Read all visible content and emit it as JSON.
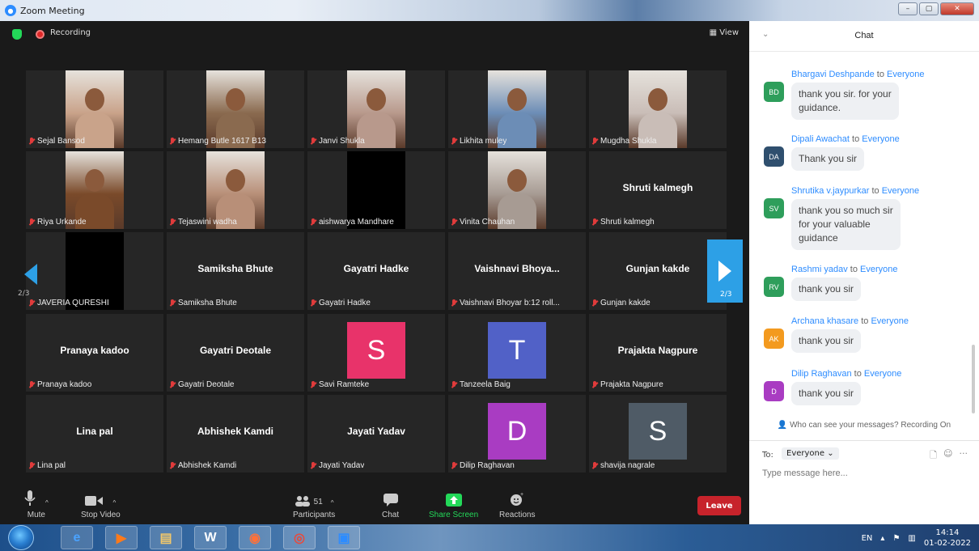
{
  "window": {
    "title": "Zoom Meeting"
  },
  "meeting": {
    "recording_label": "Recording",
    "view_label": "View",
    "page_indicator_left": "2/3",
    "page_indicator_right": "2/3",
    "tiles": [
      {
        "label": "Sejal Bansod",
        "type": "video",
        "bg": "#c9a38a"
      },
      {
        "label": "Hemang Butle 1617 B13",
        "type": "video",
        "bg": "#8a6a4f"
      },
      {
        "label": "Janvi Shukla",
        "type": "video",
        "bg": "#b8998c"
      },
      {
        "label": "Likhita muley",
        "type": "video",
        "bg": "#6c8db6"
      },
      {
        "label": "Mugdha Shukla",
        "type": "video",
        "bg": "#c9bdb7"
      },
      {
        "label": "Riya Urkande",
        "type": "video",
        "bg": "#7a4a2a"
      },
      {
        "label": "Tejaswini wadha",
        "type": "video",
        "bg": "#b88f78"
      },
      {
        "label": "aishwarya Mandhare",
        "type": "black",
        "bg": "#000000"
      },
      {
        "label": "Vinita Chauhan",
        "type": "video",
        "bg": "#a79b93"
      },
      {
        "label": "Shruti kalmegh",
        "type": "name",
        "name": "Shruti kalmegh"
      },
      {
        "label": "JAVERIA QURESHI",
        "type": "black",
        "bg": "#000000"
      },
      {
        "label": "Samiksha Bhute",
        "type": "name",
        "name": "Samiksha Bhute"
      },
      {
        "label": "Gayatri Hadke",
        "type": "name",
        "name": "Gayatri Hadke"
      },
      {
        "label": "Vaishnavi Bhoyar b:12 roll...",
        "type": "name",
        "name": "Vaishnavi  Bhoya..."
      },
      {
        "label": "Gunjan kakde",
        "type": "name",
        "name": "Gunjan kakde"
      },
      {
        "label": "Pranaya kadoo",
        "type": "name",
        "name": "Pranaya kadoo"
      },
      {
        "label": "Gayatri Deotale",
        "type": "name",
        "name": "Gayatri Deotale"
      },
      {
        "label": "Savi Ramteke",
        "type": "avatar",
        "letter": "S",
        "bg": "#e8336a"
      },
      {
        "label": "Tanzeela Baig",
        "type": "avatar",
        "letter": "T",
        "bg": "#5161c7"
      },
      {
        "label": "Prajakta Nagpure",
        "type": "name",
        "name": "Prajakta Nagpure"
      },
      {
        "label": "Lina pal",
        "type": "name",
        "name": "Lina pal"
      },
      {
        "label": "Abhishek Kamdi",
        "type": "name",
        "name": "Abhishek Kamdi"
      },
      {
        "label": "Jayati Yadav",
        "type": "name",
        "name": "Jayati Yadav"
      },
      {
        "label": "Dilip Raghavan",
        "type": "avatar",
        "letter": "D",
        "bg": "#a93cc2"
      },
      {
        "label": "shavija nagrale",
        "type": "avatar",
        "letter": "S",
        "bg": "#4f5b66"
      }
    ]
  },
  "toolbar": {
    "mute": "Mute",
    "stop_video": "Stop Video",
    "participants": "Participants",
    "participants_count": "51",
    "chat": "Chat",
    "share_screen": "Share Screen",
    "reactions": "Reactions",
    "leave": "Leave"
  },
  "chat": {
    "title": "Chat",
    "messages": [
      {
        "sender": "Bhargavi Deshpande",
        "to": "Everyone",
        "initials": "BD",
        "color": "#2e9e5b",
        "lines": [
          "thank you sir. for your",
          "guidance."
        ]
      },
      {
        "sender": "Dipali Awachat",
        "to": "Everyone",
        "initials": "DA",
        "color": "#2f4f6e",
        "lines": [
          "Thank you sir"
        ]
      },
      {
        "sender": "Shrutika v.jaypurkar",
        "to": "Everyone",
        "initials": "SV",
        "color": "#2e9e5b",
        "lines": [
          "thank you so much sir",
          "for your valuable",
          "guidance"
        ]
      },
      {
        "sender": "Rashmi yadav",
        "to": "Everyone",
        "initials": "RV",
        "color": "#2e9e5b",
        "lines": [
          "thank you sir"
        ]
      },
      {
        "sender": "Archana khasare",
        "to": "Everyone",
        "initials": "AK",
        "color": "#f39a1f",
        "lines": [
          "thank you sir"
        ]
      },
      {
        "sender": "Dilip Raghavan",
        "to": "Everyone",
        "initials": "D",
        "color": "#a93cc2",
        "lines": [
          "thank you sir"
        ]
      }
    ],
    "notice": "Who can see your messages? Recording On",
    "to_label": "To:",
    "to_value": "Everyone",
    "placeholder": "Type message here..."
  },
  "taskbar": {
    "language": "EN",
    "time": "14:14",
    "date": "01-02-2022"
  }
}
